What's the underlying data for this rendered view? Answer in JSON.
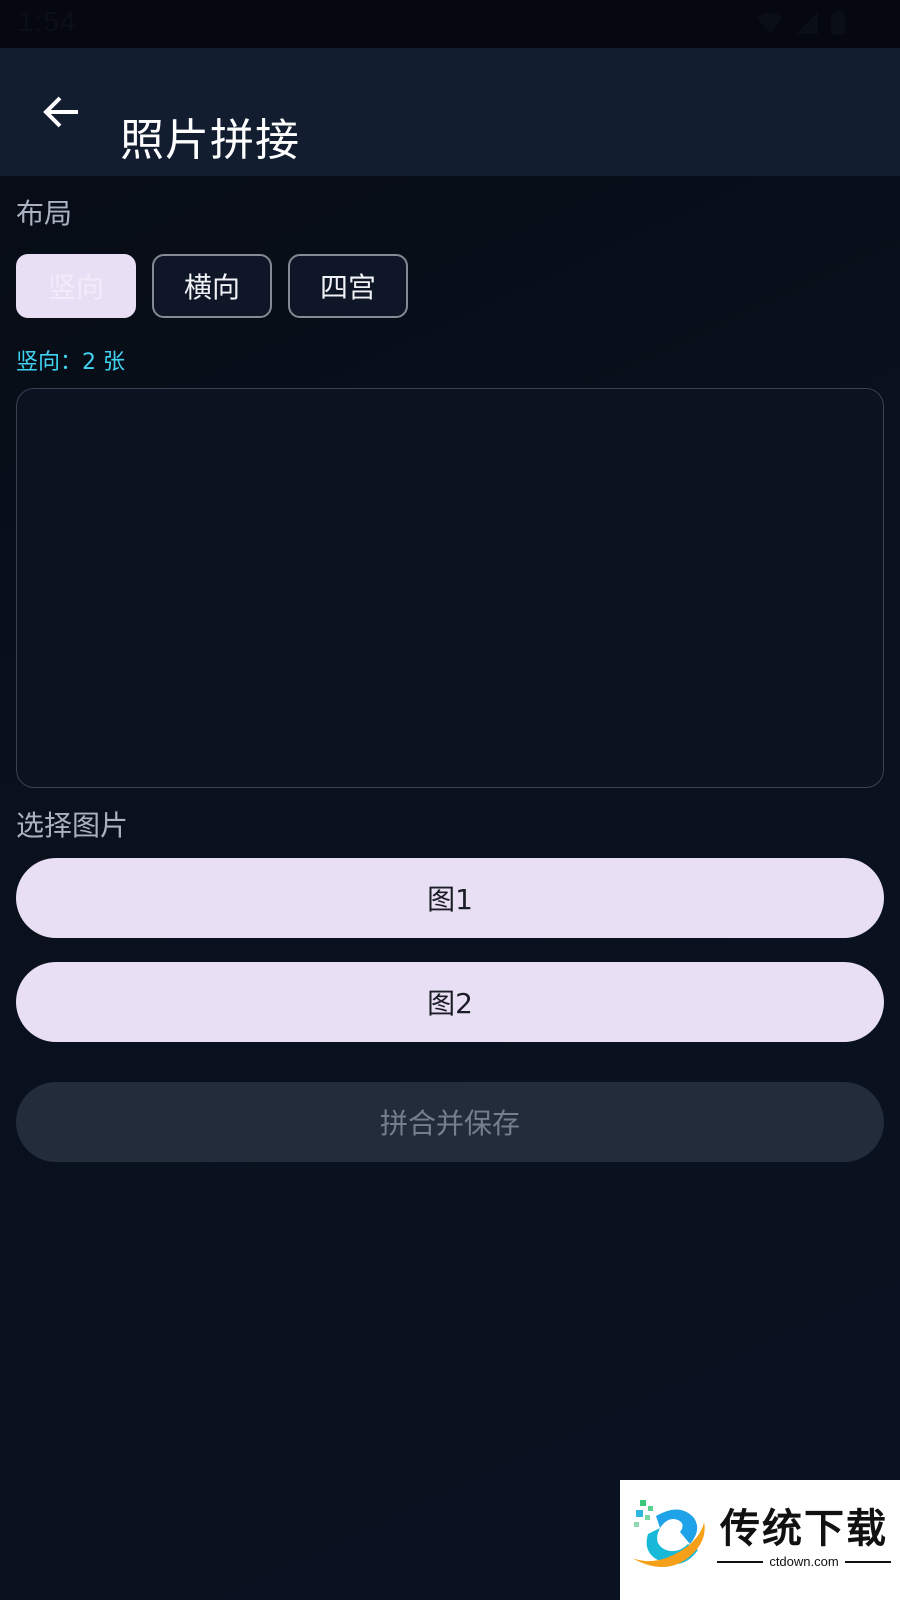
{
  "status_bar": {
    "time": "1:54",
    "icons": [
      "wifi-icon",
      "signal-icon",
      "battery-icon"
    ]
  },
  "app_bar": {
    "back_icon": "arrow-left-icon",
    "title": "照片拼接"
  },
  "layout_section": {
    "label": "布局",
    "options": [
      {
        "label": "竖向",
        "selected": true
      },
      {
        "label": "横向",
        "selected": false
      },
      {
        "label": "四宫",
        "selected": false
      }
    ],
    "count_text": "竖向：2 张"
  },
  "select_section": {
    "label": "选择图片",
    "buttons": [
      {
        "label": "图1"
      },
      {
        "label": "图2"
      }
    ]
  },
  "save_button": {
    "label": "拼合并保存",
    "enabled": false
  },
  "watermark": {
    "title": "传统下载",
    "url": "ctdown.com"
  },
  "colors": {
    "background": "#0a111d",
    "app_bar": "#121d30",
    "accent_cyan": "#40d3f2",
    "button_lavender": "#e8dff5",
    "disabled_button": "#222c3b"
  }
}
